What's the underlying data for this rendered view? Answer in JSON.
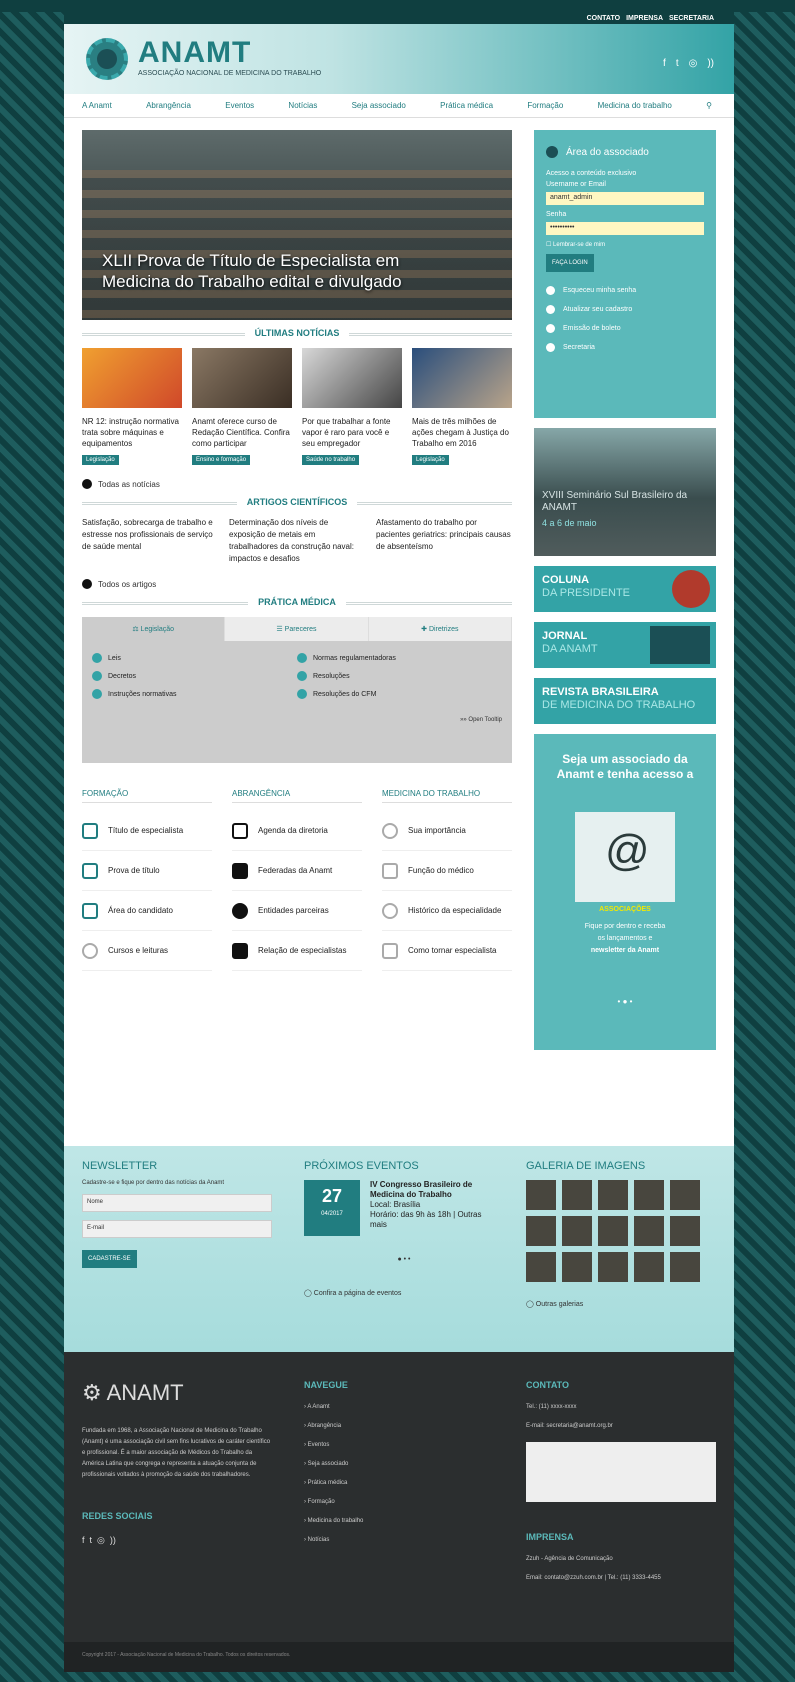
{
  "util": [
    "CONTATO",
    "IMPRENSA",
    "SECRETARIA"
  ],
  "logo": {
    "name": "ANAMT",
    "sub": "ASSOCIAÇÃO NACIONAL DE MEDICINA DO TRABALHO"
  },
  "social": [
    "f",
    "t",
    "ig",
    "rss"
  ],
  "nav": [
    "A Anamt",
    "Abrangência",
    "Eventos",
    "Notícias",
    "Seja associado",
    "Prática médica",
    "Formação",
    "Medicina do trabalho"
  ],
  "hero": {
    "title": "XLII Prova de Título de Especialista em Medicina do Trabalho edital e divulgado"
  },
  "sections": {
    "news": "ÚLTIMAS NOTÍCIAS",
    "arts": "ARTIGOS CIENTÍFICOS",
    "prat": "PRÁTICA MÉDICA"
  },
  "news": [
    {
      "t": "NR 12: instrução normativa trata sobre máquinas e equipamentos",
      "tag": "Legislação",
      "c": "#e8742e"
    },
    {
      "t": "Anamt oferece curso de Redação Científica. Confira como participar",
      "tag": "Ensino e formação",
      "c": "#6e5a48"
    },
    {
      "t": "Por que trabalhar a fonte vapor é raro para você e seu empregador",
      "tag": "Saúde no trabalho",
      "c": "#8a8a8a"
    },
    {
      "t": "Mais de três milhões de ações chegam à Justiça do Trabalho em 2016",
      "tag": "Legislação",
      "c": "#315a8a"
    }
  ],
  "news_more": "Todas as notícias",
  "arts": [
    "Satisfação, sobrecarga de trabalho e estresse nos profissionais de serviço de saúde mental",
    "Determinação dos níveis de exposição de metais em trabalhadores da construção naval: impactos e desafios",
    "Afastamento do trabalho por pacientes geriatrics: principais causas de absenteísmo"
  ],
  "arts_more": "Todos os artigos",
  "tabs": [
    "Legislação",
    "Pareceres",
    "Diretrizes"
  ],
  "tabitems": {
    "a": [
      "Leis",
      "Decretos",
      "Instruções normativas"
    ],
    "b": [
      "Normas regulamentadoras",
      "Resoluções",
      "Resoluções do CFM"
    ]
  },
  "tab_open": "Open Tooltip",
  "cols": [
    {
      "h": "FORMAÇÃO",
      "items": [
        "Título de especialista",
        "Prova de título",
        "Área do candidato",
        "Cursos e leituras"
      ]
    },
    {
      "h": "ABRANGÊNCIA",
      "items": [
        "Agenda da diretoria",
        "Federadas da Anamt",
        "Entidades parceiras",
        "Relação de especialistas"
      ]
    },
    {
      "h": "MEDICINA DO TRABALHO",
      "items": [
        "Sua importância",
        "Função do médico",
        "Histórico da especialidade",
        "Como tornar especialista"
      ]
    }
  ],
  "login": {
    "title": "Área do associado",
    "hint": "Acesso a conteúdo exclusivo",
    "l1": "Username or Email",
    "v1": "anamt_admin",
    "l2": "Senha",
    "v2": "••••••••••",
    "chk": "Lembrar-se de mim",
    "btn": "FAÇA LOGIN",
    "opts": [
      "Esqueceu minha senha",
      "Atualizar seu cadastro",
      "Emissão de boleto",
      "Secretaria"
    ]
  },
  "banner1": {
    "t": "XVIII Seminário Sul Brasileiro da ANAMT",
    "s": "4 a 6 de maio"
  },
  "banners": [
    {
      "a": "COLUNA",
      "b": "DA PRESIDENTE"
    },
    {
      "a": "JORNAL",
      "b": "DA ANAMT"
    },
    {
      "a": "REVISTA BRASILEIRA",
      "b": "DE MEDICINA DO TRABALHO"
    }
  ],
  "assoc": {
    "t": "Seja um associado da Anamt e tenha acesso a",
    "y": "ASSOCIAÇÕES",
    "s1": "Fique por dentro e receba",
    "s2": "os lançamentos e",
    "s3": "newsletter da Anamt"
  },
  "band": {
    "nl": {
      "h": "NEWSLETTER",
      "p": "Cadastre-se e fique por dentro das notícias da Anamt",
      "f1": "Nome",
      "f2": "E-mail",
      "b": "CADASTRE-SE"
    },
    "ev": {
      "h": "PRÓXIMOS EVENTOS",
      "d": "27",
      "m": "04/2017",
      "t": "IV Congresso Brasileiro de Medicina do Trabalho",
      "l": "Local: Brasília",
      "h2": "Horário: das 9h às 18h | Outras mais",
      "more": "Confira a página de eventos"
    },
    "gal": {
      "h": "GALERIA DE IMAGENS",
      "more": "Outras galerias"
    }
  },
  "foot": {
    "about": "Fundada em 1968, a Associação Nacional de Medicina do Trabalho (Anamt) é uma associação civil sem fins lucrativos de caráter científico e profissional. É a maior associação de Médicos do Trabalho da América Latina que congrega e representa a atuação conjunta de profissionais voltados à promoção da saúde dos trabalhadores.",
    "rs": "REDES SOCIAIS",
    "nav": "NAVEGUE",
    "navitems": [
      "A Anamt",
      "Abrangência",
      "Eventos",
      "Seja associado",
      "Prática médica",
      "Formação",
      "Medicina do trabalho",
      "Notícias"
    ],
    "contato": "CONTATO",
    "tel": "Tel.: (11) xxxx-xxxx",
    "email": "E-mail: secretaria@anamt.org.br",
    "imprensa": "IMPRENSA",
    "imp1": "Zzuh - Agência de Comunicação",
    "imp2": "Email: contato@zzuh.com.br | Tel.: (11) 3333-4455",
    "copy": "Copyright 2017 - Associação Nacional de Medicina do Trabalho. Todos os direitos reservados."
  }
}
